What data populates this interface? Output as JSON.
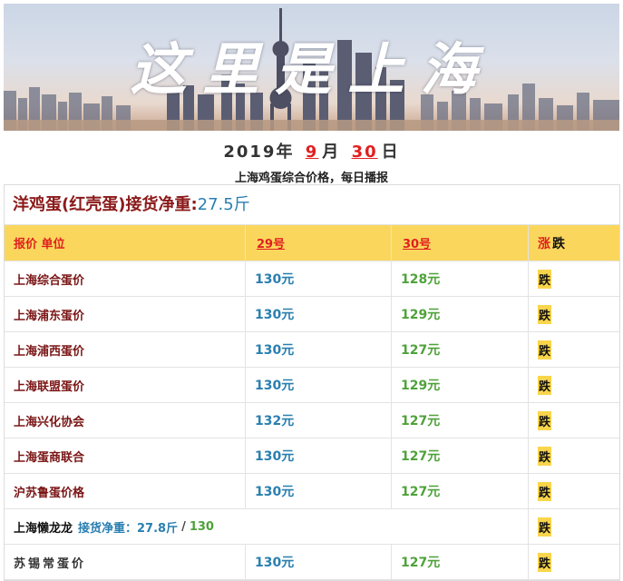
{
  "banner": {
    "title": "这里是上海"
  },
  "date": {
    "year_text": "2019年",
    "month": "9",
    "month_unit": "月",
    "day": "30",
    "day_unit": "日"
  },
  "subtitle": "上海鸡蛋综合价格，每日播报",
  "table": {
    "caption": "洋鸡蛋(红壳蛋)接货净重:",
    "caption_weight": "27.5斤",
    "header": {
      "label": "报价 单位",
      "d29": "29号",
      "d30": "30号",
      "rise": "涨",
      "fall": "跌"
    },
    "rows": [
      {
        "name": "上海综合蛋价",
        "p29": "130元",
        "p30": "128元",
        "trend": "跌"
      },
      {
        "name": "上海浦东蛋价",
        "p29": "130元",
        "p30": "129元",
        "trend": "跌"
      },
      {
        "name": "上海浦西蛋价",
        "p29": "130元",
        "p30": "127元",
        "trend": "跌"
      },
      {
        "name": "上海联盟蛋价",
        "p29": "130元",
        "p30": "129元",
        "trend": "跌"
      },
      {
        "name": "上海兴化协会",
        "p29": "132元",
        "p30": "127元",
        "trend": "跌"
      },
      {
        "name": "上海蛋商联合",
        "p29": "130元",
        "p30": "127元",
        "trend": "跌"
      },
      {
        "name": "沪苏鲁蛋价格",
        "p29": "130元",
        "p30": "127元",
        "trend": "跌"
      }
    ],
    "special_row": {
      "name": "上海懒龙龙",
      "weight_label": "接货净重：27.8斤",
      "sep": "/",
      "price": "130",
      "trend": "跌"
    },
    "last_row": {
      "name": "苏锡常蛋价",
      "p29": "130元",
      "p30": "127元",
      "trend": "跌"
    }
  }
}
